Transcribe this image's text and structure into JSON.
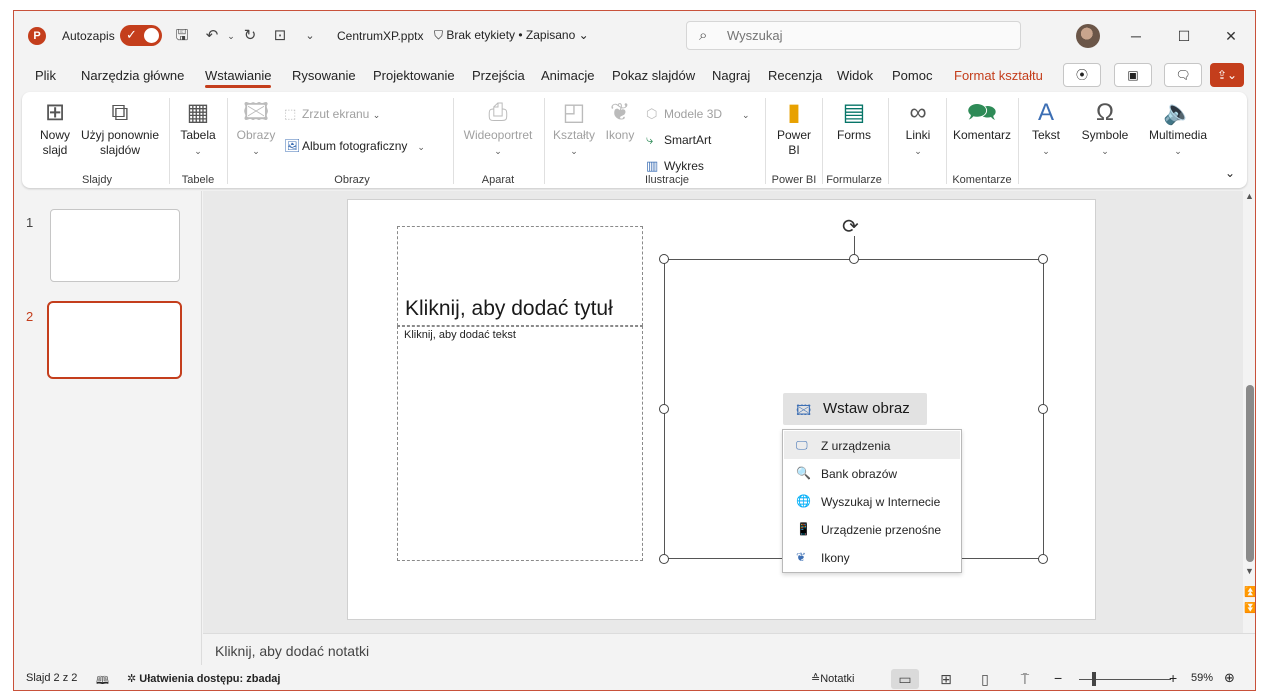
{
  "titlebar": {
    "autosave_label": "Autozapis",
    "filename": "CentrumXP.pptx",
    "label_status": "Brak etykiety • Zapisano",
    "search_placeholder": "Wyszukaj"
  },
  "tabs": [
    "Plik",
    "Narzędzia główne",
    "Wstawianie",
    "Rysowanie",
    "Projektowanie",
    "Przejścia",
    "Animacje",
    "Pokaz slajdów",
    "Nagraj",
    "Recenzja",
    "Widok",
    "Pomoc",
    "Format kształtu"
  ],
  "active_tab": "Wstawianie",
  "ribbon": {
    "new_slide": "Nowy slajd",
    "reuse_slides": "Użyj ponownie slajdów",
    "group_slides": "Slajdy",
    "table": "Tabela",
    "group_tables": "Tabele",
    "images": "Obrazy",
    "screenshot": "Zrzut ekranu",
    "photo_album": "Album fotograficzny",
    "group_images": "Obrazy",
    "camera": "Wideoportret",
    "group_camera": "Aparat",
    "shapes": "Kształty",
    "icons": "Ikony",
    "models3d": "Modele 3D",
    "smartart": "SmartArt",
    "chart": "Wykres",
    "group_illustrations": "Ilustracje",
    "powerbi": "Power BI",
    "group_powerbi": "Power BI",
    "forms": "Forms",
    "group_forms": "Formularze",
    "links": "Linki",
    "comment": "Komentarz",
    "group_comments": "Komentarze",
    "text": "Tekst",
    "symbols": "Symbole",
    "multimedia": "Multimedia"
  },
  "slides": [
    {
      "number": "1"
    },
    {
      "number": "2"
    }
  ],
  "slide": {
    "title_placeholder": "Kliknij, aby dodać tytuł",
    "text_placeholder": "Kliknij, aby dodać tekst",
    "insert_image_label": "Wstaw obraz"
  },
  "insert_menu": [
    {
      "label": "Z urządzenia",
      "icon": "device-image-icon"
    },
    {
      "label": "Bank obrazów",
      "icon": "stock-images-icon"
    },
    {
      "label": "Wyszukaj w Internecie",
      "icon": "online-image-icon"
    },
    {
      "label": "Urządzenie przenośne",
      "icon": "mobile-device-icon"
    },
    {
      "label": "Ikony",
      "icon": "icons-icon"
    }
  ],
  "notes_placeholder": "Kliknij, aby dodać notatki",
  "status": {
    "slide_count": "Slajd 2 z 2",
    "accessibility": "Ułatwienia dostępu: zbadaj",
    "notes": "Notatki",
    "zoom": "59%"
  },
  "colors": {
    "accent": "#c43e1c",
    "link_icon": "#3d6fb4"
  }
}
